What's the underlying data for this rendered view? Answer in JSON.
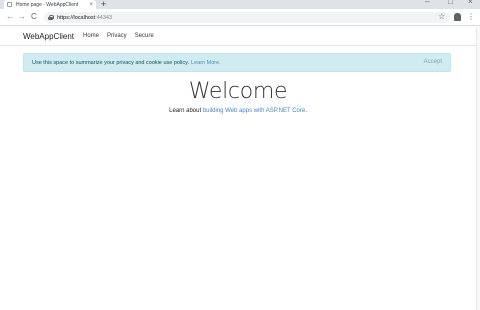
{
  "browser": {
    "tab_title": "Home page - WebAppClient",
    "tab_close": "×",
    "new_tab": "+",
    "win_minimize": "–",
    "win_maximize": "□",
    "win_close": "×",
    "back": "←",
    "forward": "→",
    "reload": "C",
    "url_host": "https://localhost",
    "url_port": ":44343",
    "star": "☆",
    "menu": "⋮"
  },
  "navbar": {
    "brand": "WebAppClient",
    "links": [
      "Home",
      "Privacy",
      "Secure"
    ]
  },
  "cookie": {
    "text": "Use this space to summarize your privacy and cookie use policy.",
    "link": "Learn More.",
    "accept": "Accept"
  },
  "main": {
    "heading": "Welcome",
    "learn_prefix": "Learn about ",
    "learn_link": "building Web apps with ASP.NET Core",
    "learn_suffix": "."
  }
}
